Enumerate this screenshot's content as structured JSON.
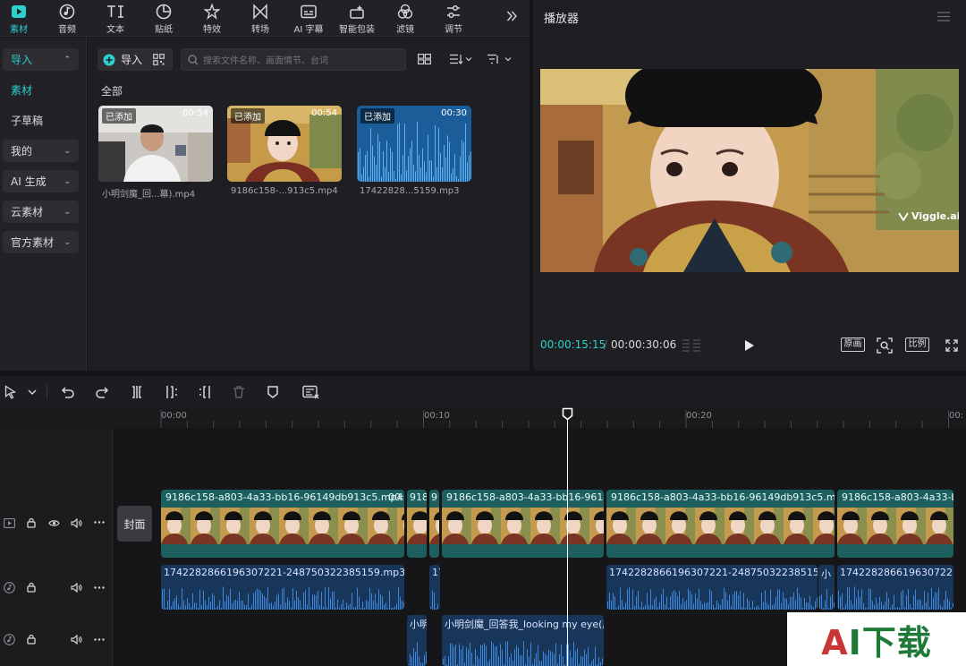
{
  "toolbar": {
    "tabs": [
      {
        "label": "素材",
        "icon": "media-icon",
        "active": true
      },
      {
        "label": "音频",
        "icon": "music-note-icon"
      },
      {
        "label": "文本",
        "icon": "text-icon"
      },
      {
        "label": "贴纸",
        "icon": "sticker-icon"
      },
      {
        "label": "特效",
        "icon": "effects-star-icon"
      },
      {
        "label": "转场",
        "icon": "transition-icon"
      },
      {
        "label": "AI 字幕",
        "icon": "ai-subtitle-icon"
      },
      {
        "label": "智能包装",
        "icon": "smart-pack-icon"
      },
      {
        "label": "滤镜",
        "icon": "filter-icon"
      },
      {
        "label": "调节",
        "icon": "adjust-icon"
      }
    ],
    "more_icon": "double-chevron-right-icon"
  },
  "sidebar": {
    "items": [
      {
        "label": "导入",
        "chevron": "⌃"
      },
      {
        "label": "素材"
      },
      {
        "label": "子草稿"
      },
      {
        "label": "我的",
        "chevron": "⌄"
      },
      {
        "label": "AI 生成",
        "chevron": "⌄"
      },
      {
        "label": "云素材",
        "chevron": "⌄"
      },
      {
        "label": "官方素材",
        "chevron": "⌄"
      }
    ]
  },
  "media": {
    "import_label": "导入",
    "search_placeholder": "搜索文件名称、画面情节、台词",
    "section_label": "全部",
    "items": [
      {
        "badge": "已添加",
        "duration": "00:54",
        "name": "小明剑魔_回...幕).mp4"
      },
      {
        "badge": "已添加",
        "duration": "00:54",
        "name": "9186c158-...913c5.mp4"
      },
      {
        "badge": "已添加",
        "duration": "00:30",
        "name": "17422828...5159.mp3"
      }
    ]
  },
  "player": {
    "title": "播放器",
    "watermark": "Viggle.ai",
    "current_time": "00:00:15:15",
    "total_time": "00:00:30:06",
    "btn_original": "原画",
    "btn_ratio": "比例"
  },
  "timeline": {
    "ruler": [
      "00:00",
      "00:10",
      "00:20",
      "00:"
    ],
    "cover_label": "封面",
    "video_clips": [
      "9186c158-a803-4a33-bb16-96149db913c5.mp4",
      "00:",
      "918",
      "9",
      "9186c158-a803-4a33-bb16-96149",
      "9186c158-a803-4a33-bb16-96149db913c5.mp4",
      "9186c158-a803-4a33-bb"
    ],
    "audio_clips": [
      "1742282866196307221-248750322385159.mp3",
      "17",
      "1742282866196307221-248750322385159.mp",
      "小",
      "1742282866196307221-24"
    ],
    "audio2_clips": [
      "小明",
      "小明剑魔_回答我_looking my eye(原音"
    ]
  },
  "overlay": {
    "logo_text": "AI下载"
  }
}
